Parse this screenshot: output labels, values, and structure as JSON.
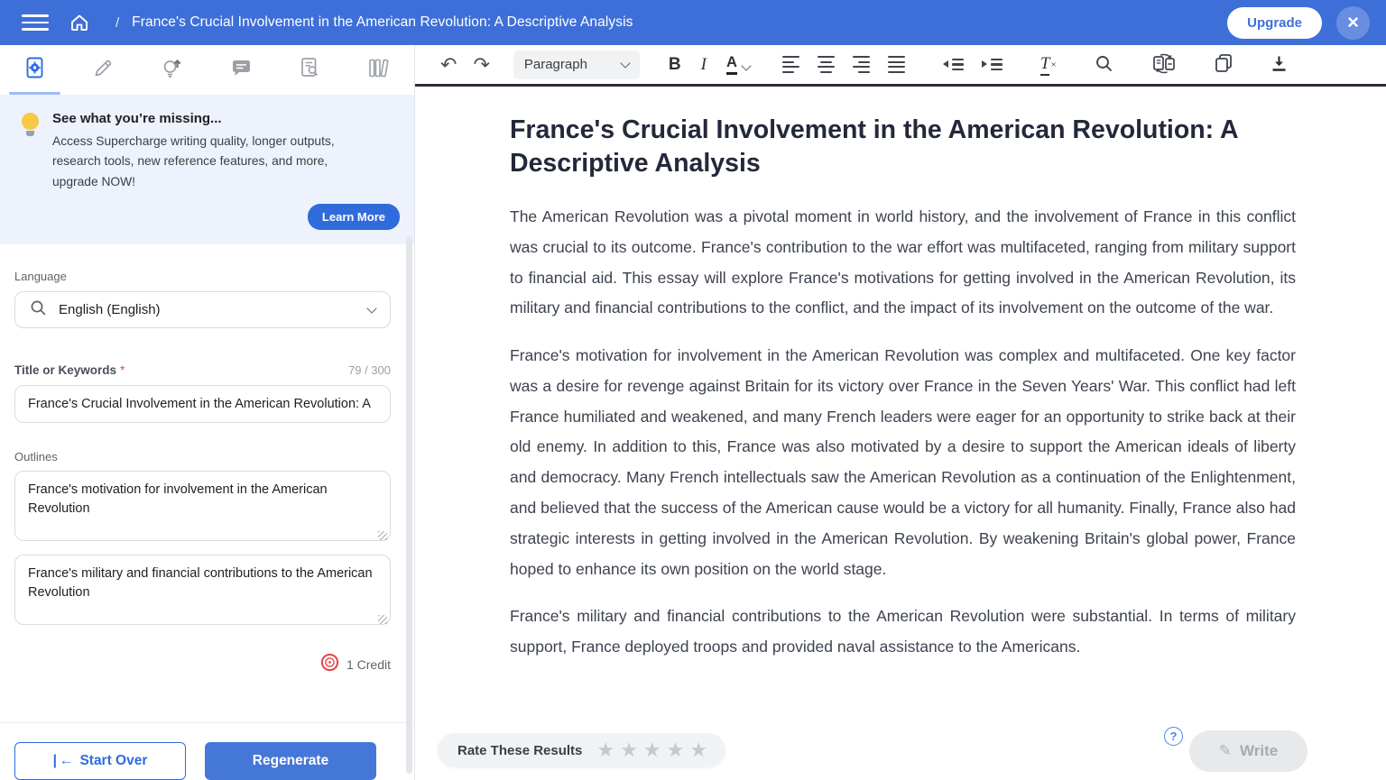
{
  "topbar": {
    "separator": "/",
    "title": "France's Crucial Involvement in the American Revolution: A Descriptive Analysis",
    "upgrade_label": "Upgrade",
    "close_glyph": "×"
  },
  "sidebar": {
    "promo": {
      "title": "See what you’re missing...",
      "body": "Access Supercharge writing quality, longer outputs, research tools, new reference features, and more, upgrade NOW!",
      "cta": "Learn More"
    },
    "language": {
      "label": "Language",
      "value": "English (English)"
    },
    "title_field": {
      "label": "Title or Keywords",
      "required_mark": "*",
      "counter": "79 / 300",
      "value": "France's Crucial Involvement in the American Revolution: A"
    },
    "outlines": {
      "label": "Outlines",
      "items": [
        "France's motivation for involvement in the American Revolution",
        "France's military and financial contributions to the American Revolution"
      ]
    },
    "credits": {
      "label": "1 Credit"
    },
    "actions": {
      "start_over": "Start Over",
      "start_over_bar": "|",
      "start_over_arrow": "←",
      "regenerate": "Regenerate"
    }
  },
  "editor": {
    "toolbar": {
      "undo_glyph": "↶",
      "redo_glyph": "↷",
      "paragraph_label": "Paragraph",
      "bold_label": "B",
      "italic_label": "I",
      "color_label": "A",
      "clear_format_t": "T",
      "clear_format_x": "×"
    },
    "document": {
      "heading": "France's Crucial Involvement in the American Revolution: A Descriptive Analysis",
      "paragraphs": [
        "The American Revolution was a pivotal moment in world history, and the involvement of France in this conflict was crucial to its outcome. France's contribution to the war effort was multifaceted, ranging from military support to financial aid. This essay will explore France's motivations for getting involved in the American Revolution, its military and financial contributions to the conflict, and the impact of its involvement on the outcome of the war.",
        "France's motivation for involvement in the American Revolution was complex and multifaceted. One key factor was a desire for revenge against Britain for its victory over France in the Seven Years' War. This conflict had left France humiliated and weakened, and many French leaders were eager for an opportunity to strike back at their old enemy. In addition to this, France was also motivated by a desire to support the American ideals of liberty and democracy. Many French intellectuals saw the American Revolution as a continuation of the Enlightenment, and believed that the success of the American cause would be a victory for all humanity. Finally, France also had strategic interests in getting involved in the American Revolution. By weakening Britain's global power, France hoped to enhance its own position on the world stage.",
        "France's military and financial contributions to the American Revolution were substantial. In terms of military support, France deployed troops and provided naval assistance to the Americans."
      ]
    },
    "rate": {
      "label": "Rate These Results",
      "star_glyph": "★",
      "stars": 5
    },
    "help_glyph": "?",
    "write": {
      "label": "Write",
      "pen_glyph": "✎"
    }
  },
  "colors": {
    "topbar": "#3E6FD8",
    "accent": "#2F6BDB",
    "credit_icon": "#E5484D",
    "active_tab": "#2E6BE5"
  }
}
